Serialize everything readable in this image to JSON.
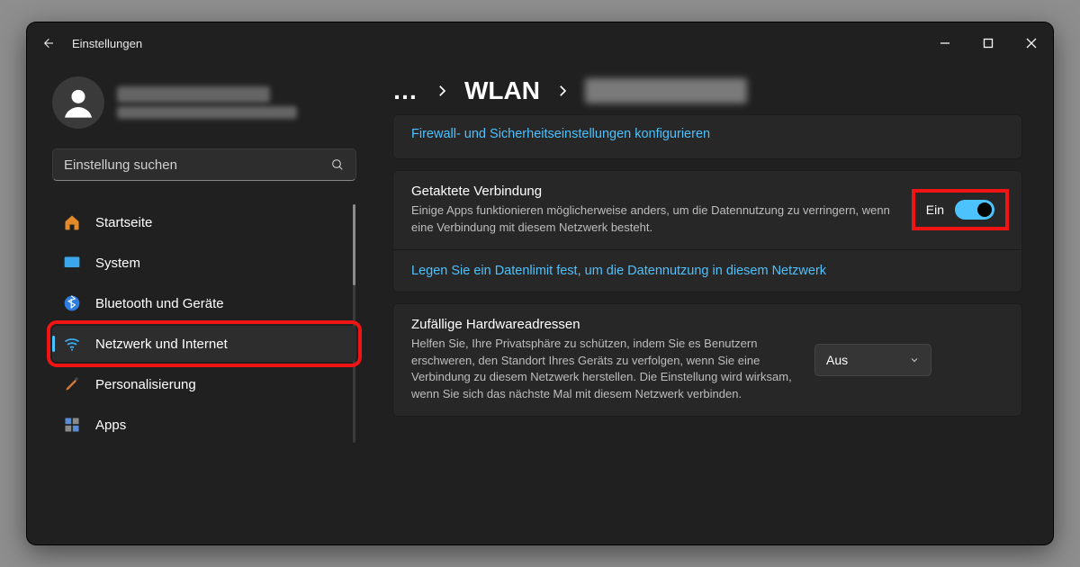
{
  "window": {
    "title": "Einstellungen"
  },
  "search": {
    "placeholder": "Einstellung suchen"
  },
  "sidebar": {
    "items": [
      {
        "label": "Startseite"
      },
      {
        "label": "System"
      },
      {
        "label": "Bluetooth und Geräte"
      },
      {
        "label": "Netzwerk und Internet"
      },
      {
        "label": "Personalisierung"
      },
      {
        "label": "Apps"
      }
    ]
  },
  "breadcrumb": {
    "wlan": "WLAN"
  },
  "firewall_link": "Firewall- und Sicherheitseinstellungen konfigurieren",
  "metered": {
    "title": "Getaktete Verbindung",
    "desc": "Einige Apps funktionieren möglicherweise anders, um die Datennutzung zu verringern, wenn eine Verbindung mit diesem Netzwerk besteht.",
    "state_label": "Ein",
    "on": true,
    "limit_link": "Legen Sie ein Datenlimit fest, um die Datennutzung in diesem Netzwerk"
  },
  "random_hw": {
    "title": "Zufällige Hardwareadressen",
    "desc": "Helfen Sie, Ihre Privatsphäre zu schützen, indem Sie es Benutzern erschweren, den Standort Ihres Geräts zu verfolgen, wenn Sie eine Verbindung zu diesem Netzwerk herstellen. Die Einstellung wird wirksam, wenn Sie sich das nächste Mal mit diesem Netzwerk verbinden.",
    "value": "Aus"
  }
}
